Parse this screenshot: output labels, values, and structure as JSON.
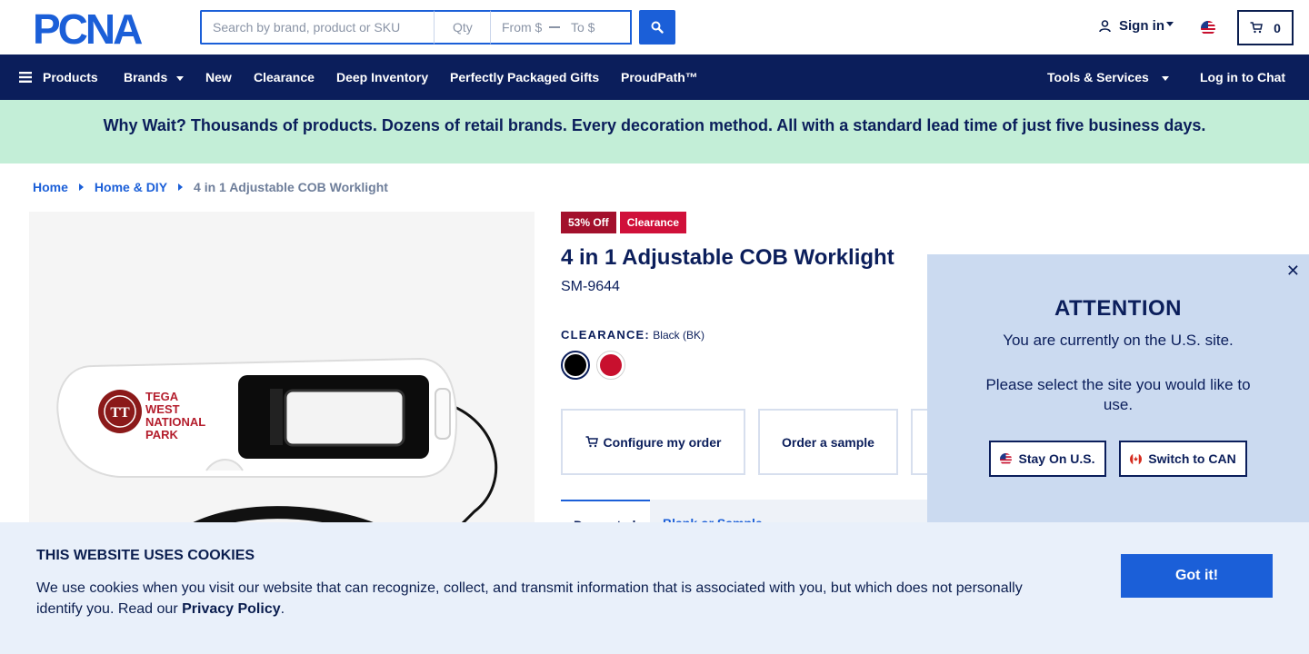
{
  "header": {
    "logo_text": "PCNA",
    "search": {
      "placeholder": "Search by brand, product or SKU",
      "value": ""
    },
    "qty": {
      "placeholder": "Qty",
      "value": ""
    },
    "price_from": {
      "placeholder": "From $",
      "value": ""
    },
    "price_to": {
      "placeholder": "To $",
      "value": ""
    },
    "signin_label": "Sign in",
    "cart_count": "0"
  },
  "nav": {
    "products": "Products",
    "brands": "Brands",
    "new": "New",
    "clearance": "Clearance",
    "deep_inventory": "Deep Inventory",
    "gifts": "Perfectly Packaged Gifts",
    "proudpath": "ProudPath™",
    "tools": "Tools & Services",
    "chat": "Log in to Chat"
  },
  "banner": {
    "text": "Why Wait? Thousands of products. Dozens of retail brands. Every decoration method. All with a standard lead time of just five business days."
  },
  "breadcrumb": {
    "home": "Home",
    "category": "Home & DIY",
    "current": "4 in 1 Adjustable COB Worklight"
  },
  "product": {
    "image_text": {
      "line1": "TEGA",
      "line2": "WEST",
      "line3": "NATIONAL",
      "line4": "PARK"
    },
    "badge_off": "53% Off",
    "badge_clearance": "Clearance",
    "title": "4 in 1 Adjustable COB Worklight",
    "sku": "SM-9644",
    "clearance_label": "CLEARANCE:",
    "selected_color": "Black (BK)",
    "swatches": [
      {
        "name": "Black",
        "color": "#000000"
      },
      {
        "name": "Red",
        "color": "#c8102e"
      }
    ],
    "actions": {
      "configure": "Configure my order",
      "sample": "Order a sample"
    },
    "tabs": {
      "active": "Decorated",
      "inactive": "Blank or Sample"
    }
  },
  "attention": {
    "title": "ATTENTION",
    "line1": "You are currently on the U.S. site.",
    "line2": "Please select the site you would like to use.",
    "stay": "Stay On U.S.",
    "switch": "Switch to CAN"
  },
  "cookie": {
    "title": "THIS WEBSITE USES COOKIES",
    "text": "We use cookies when you visit our website that can recognize, collect, and transmit information that is associated with you, but which does not personally identify you. Read our ",
    "link": "Privacy Policy",
    "period": ".",
    "button": "Got it!"
  },
  "colors": {
    "navy": "#0b1e5b",
    "accent_blue": "#1b5fd8",
    "banner_green": "#c3eed7",
    "badge_red": "#d0103a"
  }
}
